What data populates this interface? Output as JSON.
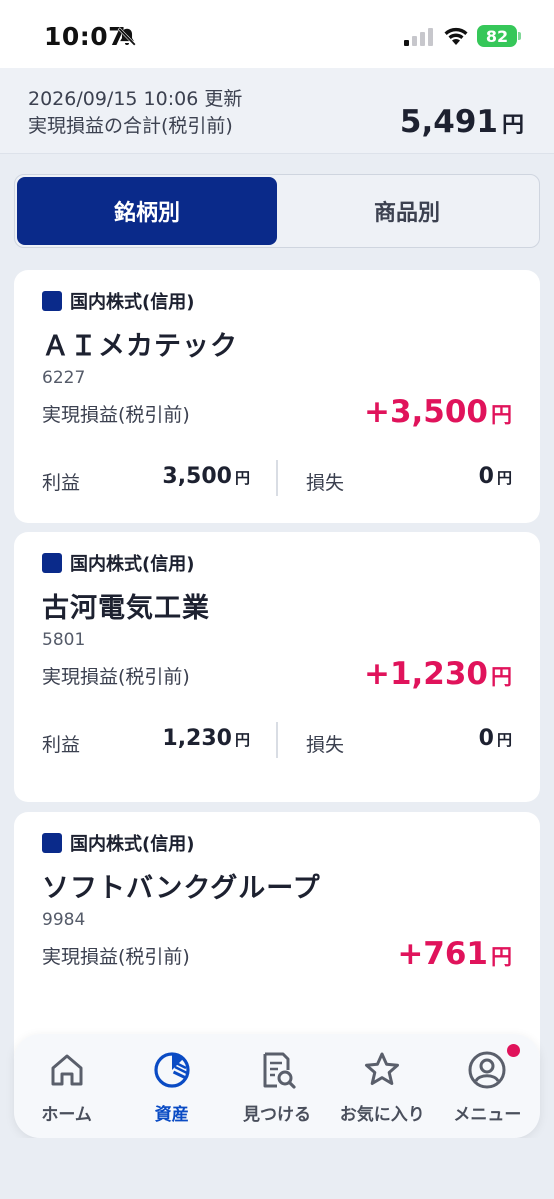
{
  "status_bar": {
    "time": "10:07",
    "battery": "82"
  },
  "summary": {
    "updated_at": "2026/09/15 10:06 更新",
    "label": "実現損益の合計(税引前)",
    "total": "5,491",
    "unit": "円"
  },
  "tabs": [
    {
      "label": "銘柄別",
      "active": true
    },
    {
      "label": "商品別",
      "active": false
    }
  ],
  "cards": [
    {
      "category": "国内株式(信用)",
      "name": "ＡＩメカテック",
      "code": "6227",
      "pl_label": "実現損益(税引前)",
      "pl_value": "+3,500",
      "unit": "円",
      "profit_label": "利益",
      "profit": "3,500",
      "loss_label": "損失",
      "loss": "0"
    },
    {
      "category": "国内株式(信用)",
      "name": "古河電気工業",
      "code": "5801",
      "pl_label": "実現損益(税引前)",
      "pl_value": "+1,230",
      "unit": "円",
      "profit_label": "利益",
      "profit": "1,230",
      "loss_label": "損失",
      "loss": "0"
    },
    {
      "category": "国内株式(信用)",
      "name": "ソフトバンクグループ",
      "code": "9984",
      "pl_label": "実現損益(税引前)",
      "pl_value": "+761",
      "unit": "円"
    }
  ],
  "bottom_nav": [
    {
      "label": "ホーム",
      "icon": "home-icon"
    },
    {
      "label": "資産",
      "icon": "pie-chart-icon"
    },
    {
      "label": "見つける",
      "icon": "document-search-icon"
    },
    {
      "label": "お気に入り",
      "icon": "star-icon"
    },
    {
      "label": "メニュー",
      "icon": "user-icon"
    }
  ],
  "colors": {
    "accent": "#0a2a8a",
    "positive": "#e0135b",
    "nav_active": "#0a4bc4"
  }
}
